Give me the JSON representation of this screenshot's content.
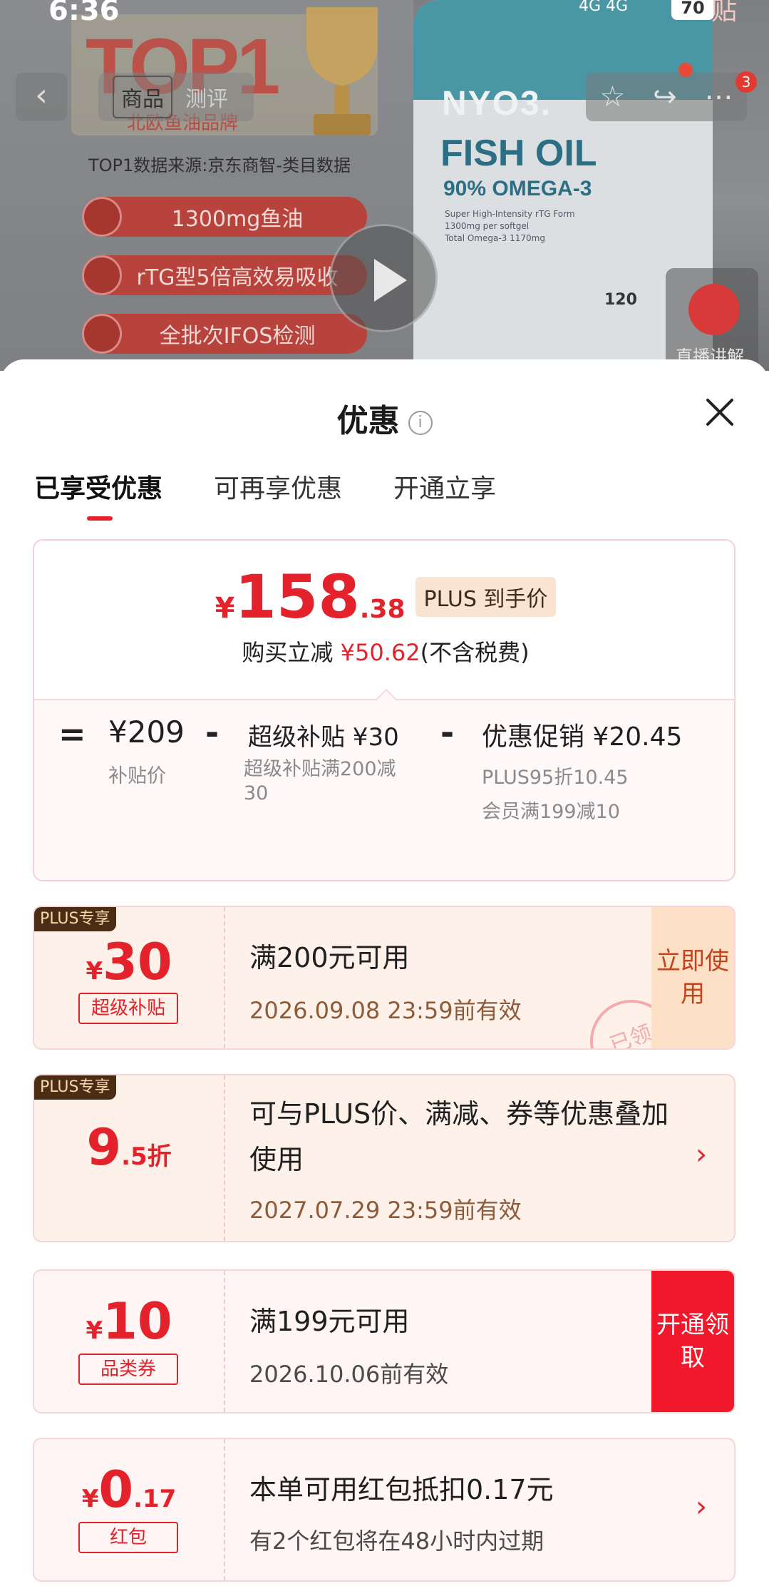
{
  "status_bar": {
    "time": "6:36",
    "signal": "4G 4G",
    "battery": "70",
    "subsidy_tag": "贴"
  },
  "nav": {
    "back_icon": "chevron-left-icon",
    "tab_product": "商品",
    "tab_review": "测评",
    "badge_count": "3"
  },
  "product_image": {
    "top1": "TOP1",
    "brand_sub": "北欧鱼油品牌",
    "data_source": "TOP1数据来源:京东商智-类目数据",
    "pills": [
      "1300mg鱼油",
      "rTG型5倍高效易吸收",
      "全批次IFOS检测"
    ],
    "bottle_brand": "NYO3.",
    "bottle_name": "FISH OIL",
    "bottle_omega": "90% OMEGA-3",
    "bottle_small": [
      "Super High-Intensity rTG Form",
      "1300mg per softgel",
      "Total Omega-3 1170mg"
    ],
    "bottle_count": "120",
    "live_label": "直播讲解"
  },
  "sheet": {
    "title": "优惠",
    "tabs": [
      "已享受优惠",
      "可再享优惠",
      "开通立享"
    ],
    "summary": {
      "currency": "¥",
      "price_int": "158",
      "price_dec": ".38",
      "plus_tag": "PLUS 到手价",
      "reduce_prefix": "购买立减",
      "reduce_amount": "¥50.62",
      "reduce_suffix": "(不含税费)",
      "eq": "=",
      "minus": "-",
      "base_price": "¥209",
      "base_label": "补贴价",
      "subsidy_title": "超级补贴 ¥30",
      "subsidy_desc": "超级补贴满200减30",
      "promo_title": "优惠促销 ¥20.45",
      "promo_line1": "PLUS95折10.45",
      "promo_line2": "会员满199减10"
    },
    "coupons": [
      {
        "badge": "PLUS专享",
        "currency": "¥",
        "amount": "30",
        "tag": "超级补贴",
        "title": "满200元可用",
        "date": "2026.09.08 23:59前有效",
        "button": "立即使用",
        "stamp": "已领"
      },
      {
        "badge": "PLUS专享",
        "amount": "9",
        "amount_dec": ".5折",
        "title": "可与PLUS价、满减、券等优惠叠加使用",
        "date": "2027.07.29 23:59前有效"
      },
      {
        "currency": "¥",
        "amount": "10",
        "tag": "品类券",
        "title": "满199元可用",
        "date": "2026.10.06前有效",
        "button": "开通领取"
      },
      {
        "currency": "¥",
        "amount": "0",
        "amount_dec": ".17",
        "tag": "红包",
        "title": "本单可用红包抵扣0.17元",
        "date": "有2个红包将在48小时内过期"
      }
    ]
  },
  "colors": {
    "accent_red": "#e4222b",
    "plus_brown": "#4b2d16",
    "open_button": "#f0182a"
  }
}
